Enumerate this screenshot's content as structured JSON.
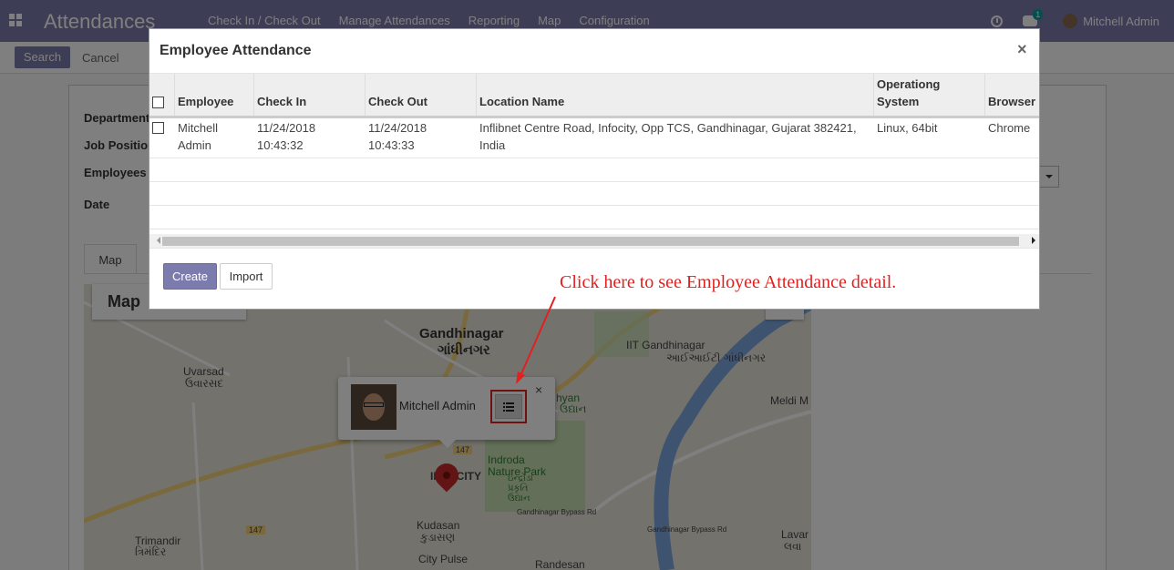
{
  "navbar": {
    "app_title": "Attendances",
    "menu": [
      "Check In / Check Out",
      "Manage Attendances",
      "Reporting",
      "Map",
      "Configuration"
    ],
    "chat_badge": "1",
    "user_name": "Mitchell Admin"
  },
  "control": {
    "search_label": "Search",
    "cancel_label": "Cancel"
  },
  "form": {
    "labels": [
      "Department",
      "Job Position",
      "Employees",
      "Date"
    ],
    "tab_label": "Map"
  },
  "map": {
    "panel_title": "Map",
    "places": {
      "gandhinagar": "Gandhinagar",
      "gandhinagar_local": "ગાંધીનગર",
      "uvarsad": "Uvarsad",
      "uvarsad_local": "ઉવારસદ",
      "iit": "IIT Gandhinagar",
      "iit_local": "આઈઆઈટી ગાંધીનગર",
      "indroda": "Indroda Nature Park",
      "indroda_local": "ઇન્દ્રોડા પ્રકૃતિ ઉદ્યાન",
      "kudasan": "Kudasan",
      "kudasan_local": "કુડાસણ",
      "city_pulse": "City Pulse",
      "trimandir": "Trimandir",
      "trimandir_local": "ત્રિમંદિર",
      "randesan": "Randesan",
      "meldi": "Meldi M",
      "lavarpur": "Lavar",
      "lavarpur_local": "લવા",
      "infocity": "INFOCITY",
      "chhyan": "hyan",
      "chhyan_local": "ઉદ્યાન",
      "road_147a": "147",
      "road_147b": "147",
      "bypass1": "Gandhinagar Bypass Rd",
      "bypass2": "Gandhinagar Bypass Rd"
    },
    "info_window": {
      "name": "Mitchell Admin",
      "close": "×"
    }
  },
  "modal": {
    "title": "Employee Attendance",
    "close": "×",
    "columns": [
      "Employee",
      "Check In",
      "Check Out",
      "Location Name",
      "Operationg System",
      "Browser"
    ],
    "rows": [
      {
        "employee": "Mitchell Admin",
        "check_in": "11/24/2018 10:43:32",
        "check_out": "11/24/2018 10:43:33",
        "location": "Inflibnet Centre Road, Infocity, Opp TCS, Gandhinagar, Gujarat 382421, India",
        "os": "Linux, 64bit",
        "browser": "Chrome"
      }
    ],
    "create_label": "Create",
    "import_label": "Import"
  },
  "annotation": {
    "text": "Click here to see Employee Attendance detail.",
    "color": "#e41f1f"
  },
  "colors": {
    "brand": "#7c7bad",
    "highlight": "#e41f1f"
  }
}
